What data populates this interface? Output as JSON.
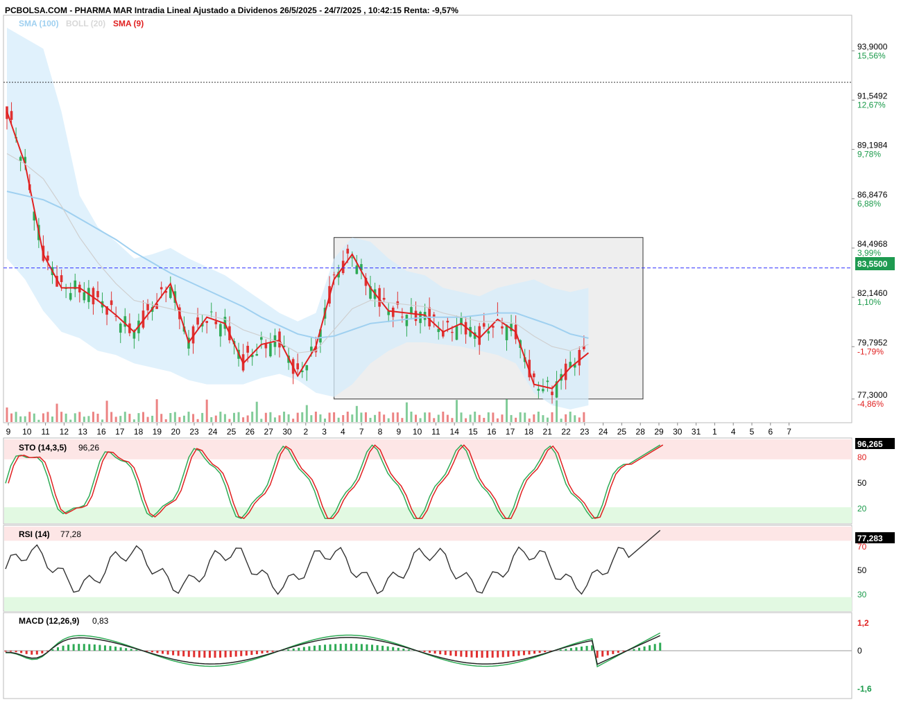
{
  "header": {
    "title": "PCBOLSA.COM - PHARMA MAR Intradia Lineal Ajustado a Dividenos 26/5/2025 - 24/7/2025 , 10:42:15 Renta: -9,57%"
  },
  "legend": [
    {
      "label": "SMA (100)",
      "color": "#9fd0f0"
    },
    {
      "label": "BOLL (20)",
      "color": "#d8d8d8"
    },
    {
      "label": "SMA (9)",
      "color": "#e02020"
    }
  ],
  "colors": {
    "up": "#2eaa55",
    "down": "#e03030",
    "sma9": "#e02020",
    "sma100": "#9fd0f0",
    "boll_fill": "#d6ecfb",
    "last_price_line": "#3030ff",
    "last_price_badge": "#1e9a50"
  },
  "price_axis": {
    "levels": [
      {
        "price": "93,9000",
        "pct": "15,56%",
        "sign": "pos"
      },
      {
        "price": "91,5492",
        "pct": "12,67%",
        "sign": "pos"
      },
      {
        "price": "89,1984",
        "pct": "9,78%",
        "sign": "pos"
      },
      {
        "price": "86,8476",
        "pct": "6,88%",
        "sign": "pos"
      },
      {
        "price": "84,4968",
        "pct": "3,99%",
        "sign": "pos"
      },
      {
        "price": "82,1460",
        "pct": "1,10%",
        "sign": "pos"
      },
      {
        "price": "79,7952",
        "pct": "-1,79%",
        "sign": "neg"
      },
      {
        "price": "77,3000",
        "pct": "-4,86%",
        "sign": "neg"
      }
    ],
    "last_price": "83,5500",
    "reference_price": 92.4
  },
  "date_ticks": [
    "9",
    "10",
    "11",
    "12",
    "13",
    "16",
    "17",
    "18",
    "19",
    "20",
    "23",
    "24",
    "25",
    "26",
    "27",
    "30",
    "2",
    "3",
    "4",
    "7",
    "8",
    "9",
    "10",
    "11",
    "14",
    "15",
    "16",
    "17",
    "18",
    "21",
    "22",
    "23",
    "24",
    "25",
    "28",
    "29",
    "30",
    "31",
    "1",
    "4",
    "5",
    "6",
    "7"
  ],
  "range_box": {
    "from_session": 18,
    "to_session": 35,
    "top_price": 85.0,
    "bottom_price": 77.3
  },
  "panels": {
    "sto": {
      "label": "STO (14,3,5)",
      "value": "96,26",
      "badge": "96,265",
      "levels": [
        "80",
        "50",
        "20"
      ]
    },
    "rsi": {
      "label": "RSI (14)",
      "value": "77,28",
      "badge": "77,283",
      "levels": [
        "70",
        "50",
        "30"
      ]
    },
    "macd": {
      "label": "MACD (12,26,9)",
      "value": "0,83",
      "levels": [
        "1,2",
        "0",
        "-1,6"
      ]
    }
  },
  "chart_data": {
    "type": "line",
    "x_label": "",
    "y_label": "",
    "ylim": [
      76.5,
      95.0
    ],
    "x": [
      "9",
      "10",
      "11",
      "12",
      "13",
      "16",
      "17",
      "18",
      "19",
      "20",
      "23",
      "24",
      "25",
      "26",
      "27",
      "30",
      "2",
      "3",
      "4",
      "7",
      "8",
      "9",
      "10",
      "11",
      "14",
      "15",
      "16",
      "17",
      "18",
      "21",
      "22",
      "23",
      "24"
    ],
    "series": [
      {
        "name": "SMA (9)",
        "values": [
          91.0,
          88.5,
          84.2,
          82.6,
          82.6,
          82.0,
          81.3,
          80.5,
          81.6,
          82.8,
          80.0,
          81.2,
          80.9,
          79.0,
          79.9,
          80.1,
          78.4,
          79.8,
          83.0,
          84.2,
          82.6,
          81.5,
          81.4,
          81.3,
          80.5,
          80.9,
          80.2,
          81.1,
          80.5,
          78.0,
          77.8,
          78.8,
          79.5
        ]
      },
      {
        "name": "SMA (100)",
        "values": [
          87.2,
          87.0,
          86.8,
          86.4,
          85.9,
          85.4,
          84.9,
          84.3,
          83.8,
          83.3,
          82.9,
          82.5,
          82.1,
          81.7,
          81.2,
          80.8,
          80.4,
          80.2,
          80.3,
          80.6,
          80.9,
          81.0,
          81.1,
          81.2,
          81.2,
          81.2,
          81.3,
          81.4,
          81.4,
          81.1,
          80.8,
          80.4,
          80.2
        ]
      },
      {
        "name": "BOLL (20)",
        "values": [
          89.0,
          88.5,
          87.8,
          86.5,
          85.0,
          83.8,
          82.8,
          82.0,
          81.8,
          81.6,
          81.4,
          81.3,
          81.1,
          80.6,
          80.3,
          80.0,
          79.5,
          79.6,
          80.6,
          81.6,
          82.0,
          81.9,
          81.8,
          81.7,
          81.4,
          81.2,
          81.0,
          81.0,
          80.9,
          80.3,
          79.8,
          79.6,
          79.9
        ]
      }
    ],
    "bands": {
      "upper": [
        95.0,
        94.5,
        94.0,
        91.0,
        87.0,
        85.5,
        84.8,
        84.0,
        84.2,
        84.5,
        84.0,
        83.6,
        83.2,
        82.6,
        82.0,
        81.4,
        81.0,
        81.4,
        84.0,
        85.0,
        84.8,
        84.0,
        83.4,
        83.2,
        82.6,
        82.4,
        82.2,
        82.6,
        82.8,
        83.0,
        82.6,
        82.4,
        82.6
      ],
      "lower": [
        84.0,
        83.0,
        81.5,
        80.5,
        80.2,
        79.6,
        79.4,
        79.0,
        78.8,
        78.6,
        78.2,
        78.0,
        78.0,
        78.0,
        78.3,
        78.5,
        78.2,
        77.6,
        77.4,
        78.0,
        79.0,
        79.6,
        80.0,
        80.0,
        79.9,
        79.8,
        79.6,
        79.4,
        79.0,
        77.6,
        77.0,
        76.8,
        77.0
      ]
    }
  }
}
